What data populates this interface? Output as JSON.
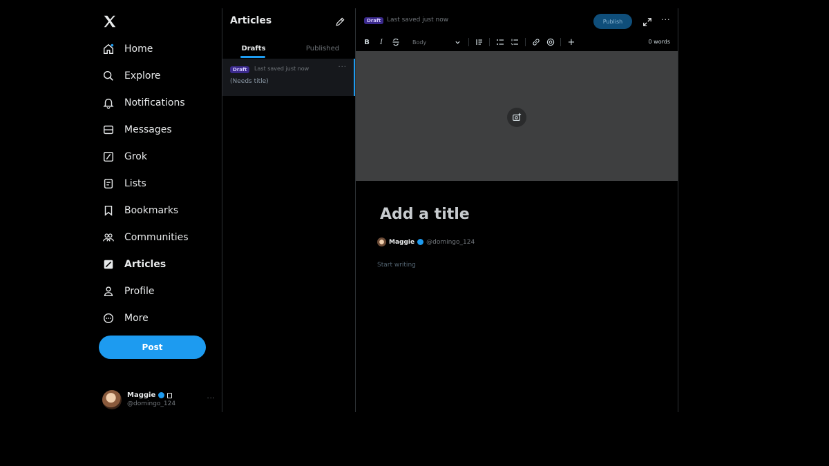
{
  "nav": {
    "items": [
      {
        "label": "Home"
      },
      {
        "label": "Explore"
      },
      {
        "label": "Notifications"
      },
      {
        "label": "Messages"
      },
      {
        "label": "Grok"
      },
      {
        "label": "Lists"
      },
      {
        "label": "Bookmarks"
      },
      {
        "label": "Communities"
      },
      {
        "label": "Articles"
      },
      {
        "label": "Profile"
      },
      {
        "label": "More"
      }
    ],
    "post_label": "Post"
  },
  "account": {
    "name": "Maggie",
    "handle": "@domingo_124"
  },
  "articles": {
    "title": "Articles",
    "tabs": [
      {
        "label": "Drafts"
      },
      {
        "label": "Published"
      }
    ],
    "draft": {
      "badge": "Draft",
      "saved": "Last saved just now",
      "title": "(Needs title)"
    }
  },
  "editor": {
    "badge": "Draft",
    "saved": "Last saved just now",
    "publish_label": "Publish",
    "toolbar": {
      "bold": "B",
      "italic": "I",
      "style": "Body",
      "words": "0 words"
    },
    "title_placeholder": "Add a title",
    "author_name": "Maggie",
    "author_handle": "@domingo_124",
    "body_placeholder": "Start writing"
  },
  "colors": {
    "accent": "#1d9bf0",
    "background": "#000000",
    "badge": "#3b2a8c",
    "cover": "#3e3f40"
  }
}
